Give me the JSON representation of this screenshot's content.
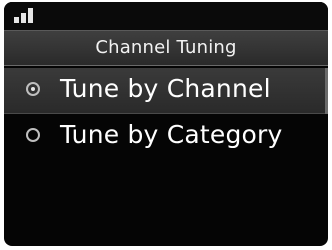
{
  "screen": {
    "title": "Channel Tuning"
  },
  "status_bar": {
    "signal_icon": "signal-strength-icon",
    "signal_level": 3,
    "signal_max": 3
  },
  "menu": {
    "items": [
      {
        "label": "Tune by Channel",
        "selected": true,
        "icon": "radio-button-selected-icon"
      },
      {
        "label": "Tune by Category",
        "selected": false,
        "icon": "radio-button-unselected-icon"
      }
    ]
  },
  "colors": {
    "screen_bg": "#050505",
    "title_bar_bg": "#3a3a3a",
    "selected_bg": "#333333",
    "text": "#ffffff",
    "radio": "#bfbfbf"
  }
}
